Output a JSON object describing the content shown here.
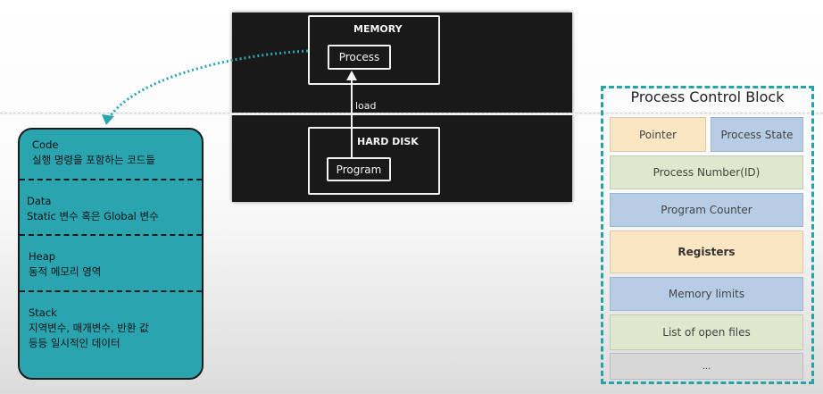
{
  "memory_diagram": {
    "memory_label": "MEMORY",
    "process_label": "Process",
    "load_label": "load",
    "hard_disk_label": "HARD DISK",
    "program_label": "Program"
  },
  "process_segments": [
    {
      "title": "Code",
      "desc": [
        "실행 명령을 포함하는 코드들"
      ]
    },
    {
      "title": "Data",
      "desc": [
        "Static 변수 혹은 Global 변수"
      ]
    },
    {
      "title": "Heap",
      "desc": [
        "동적 메모리 영역"
      ]
    },
    {
      "title": "Stack",
      "desc": [
        "지역변수, 매개변수, 반환 값",
        "등등 일시적인 데이터"
      ]
    }
  ],
  "pcb": {
    "title": "Process Control Block",
    "fields": [
      "Pointer",
      "Process State",
      "Process Number(ID)",
      "Program Counter",
      "Registers",
      "Memory limits",
      "List of open files",
      "..."
    ]
  },
  "colors": {
    "teal": "#2aa5b0",
    "yellow": "#fbe6c3",
    "blue": "#b7cde6",
    "green": "#dde8cf",
    "gray": "#d7d7d7"
  }
}
